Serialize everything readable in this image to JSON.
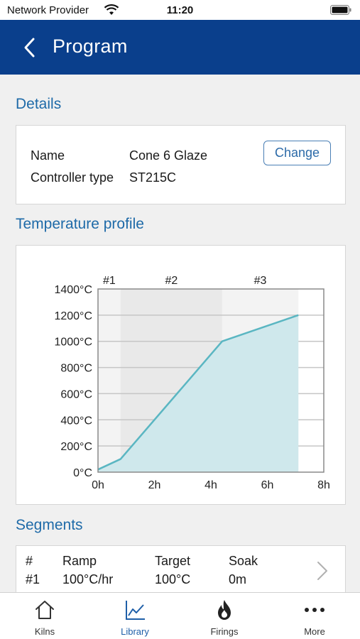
{
  "status_bar": {
    "carrier": "Network Provider",
    "time": "11:20"
  },
  "nav": {
    "title": "Program"
  },
  "details": {
    "section_title": "Details",
    "name_label": "Name",
    "name_value": "Cone 6 Glaze",
    "controller_label": "Controller type",
    "controller_value": "ST215C",
    "change_label": "Change"
  },
  "profile": {
    "section_title": "Temperature profile"
  },
  "chart_data": {
    "type": "area",
    "x_unit": "h",
    "y_unit": "°C",
    "xlim": [
      0,
      8
    ],
    "ylim": [
      0,
      1400
    ],
    "x_ticks": [
      "0h",
      "2h",
      "4h",
      "6h",
      "8h"
    ],
    "y_ticks": [
      "0°C",
      "200°C",
      "400°C",
      "600°C",
      "800°C",
      "1000°C",
      "1200°C",
      "1400°C"
    ],
    "segment_labels": [
      "#1",
      "#2",
      "#3"
    ],
    "segment_bounds_hours": [
      [
        0,
        0.8
      ],
      [
        0.8,
        4.4
      ],
      [
        4.4,
        7.1
      ]
    ],
    "x": [
      0,
      0.8,
      4.4,
      7.1,
      7.1
    ],
    "y": [
      20,
      100,
      1000,
      1200,
      1200
    ],
    "fill_color": "#cfe8ec",
    "line_color": "#5ab6c2",
    "grid": true
  },
  "segments": {
    "section_title": "Segments",
    "headers": [
      "#",
      "Ramp",
      "Target",
      "Soak"
    ],
    "rows": [
      [
        "#1",
        "100°C/hr",
        "100°C",
        "0m"
      ]
    ]
  },
  "tabs": [
    {
      "label": "Kilns",
      "icon": "house-icon",
      "active": false
    },
    {
      "label": "Library",
      "icon": "chart-icon",
      "active": true
    },
    {
      "label": "Firings",
      "icon": "flame-icon",
      "active": false
    },
    {
      "label": "More",
      "icon": "ellipsis-icon",
      "active": false
    }
  ],
  "colors": {
    "nav_bg": "#0a3f8c",
    "accent": "#1e6aa8",
    "active_tab": "#1e5fa8"
  }
}
